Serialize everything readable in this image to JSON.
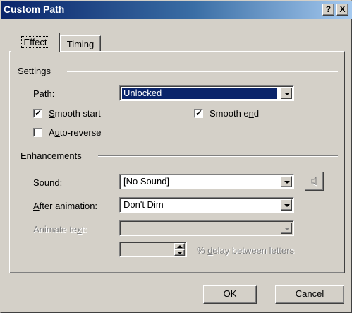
{
  "window": {
    "title": "Custom Path",
    "help_label": "?",
    "close_label": "X"
  },
  "tabs": [
    {
      "label": "Effect",
      "active": true
    },
    {
      "label": "Timing",
      "active": false
    }
  ],
  "settings": {
    "group_title": "Settings",
    "path_label_pre": "Pat",
    "path_label_u": "h",
    "path_label_post": ":",
    "path_value": "Unlocked",
    "smooth_start": {
      "pre": "",
      "u": "S",
      "post": "mooth start",
      "checked": true
    },
    "smooth_end": {
      "pre": "Smooth e",
      "u": "n",
      "post": "d",
      "checked": true
    },
    "auto_reverse": {
      "pre": "A",
      "u": "u",
      "post": "to-reverse",
      "checked": false
    }
  },
  "enhancements": {
    "group_title": "Enhancements",
    "sound_label_u": "S",
    "sound_label_post": "ound:",
    "sound_value": "[No Sound]",
    "after_label_u": "A",
    "after_label_post": "fter animation:",
    "after_value": "Don't Dim",
    "animate_label_pre": "Animate te",
    "animate_label_u": "x",
    "animate_label_post": "t:",
    "animate_value": "",
    "delay_value": "",
    "delay_label_pre": "% ",
    "delay_label_u": "d",
    "delay_label_post": "elay between letters"
  },
  "buttons": {
    "ok": "OK",
    "cancel": "Cancel"
  },
  "icons": {
    "speaker": "speaker-icon"
  }
}
